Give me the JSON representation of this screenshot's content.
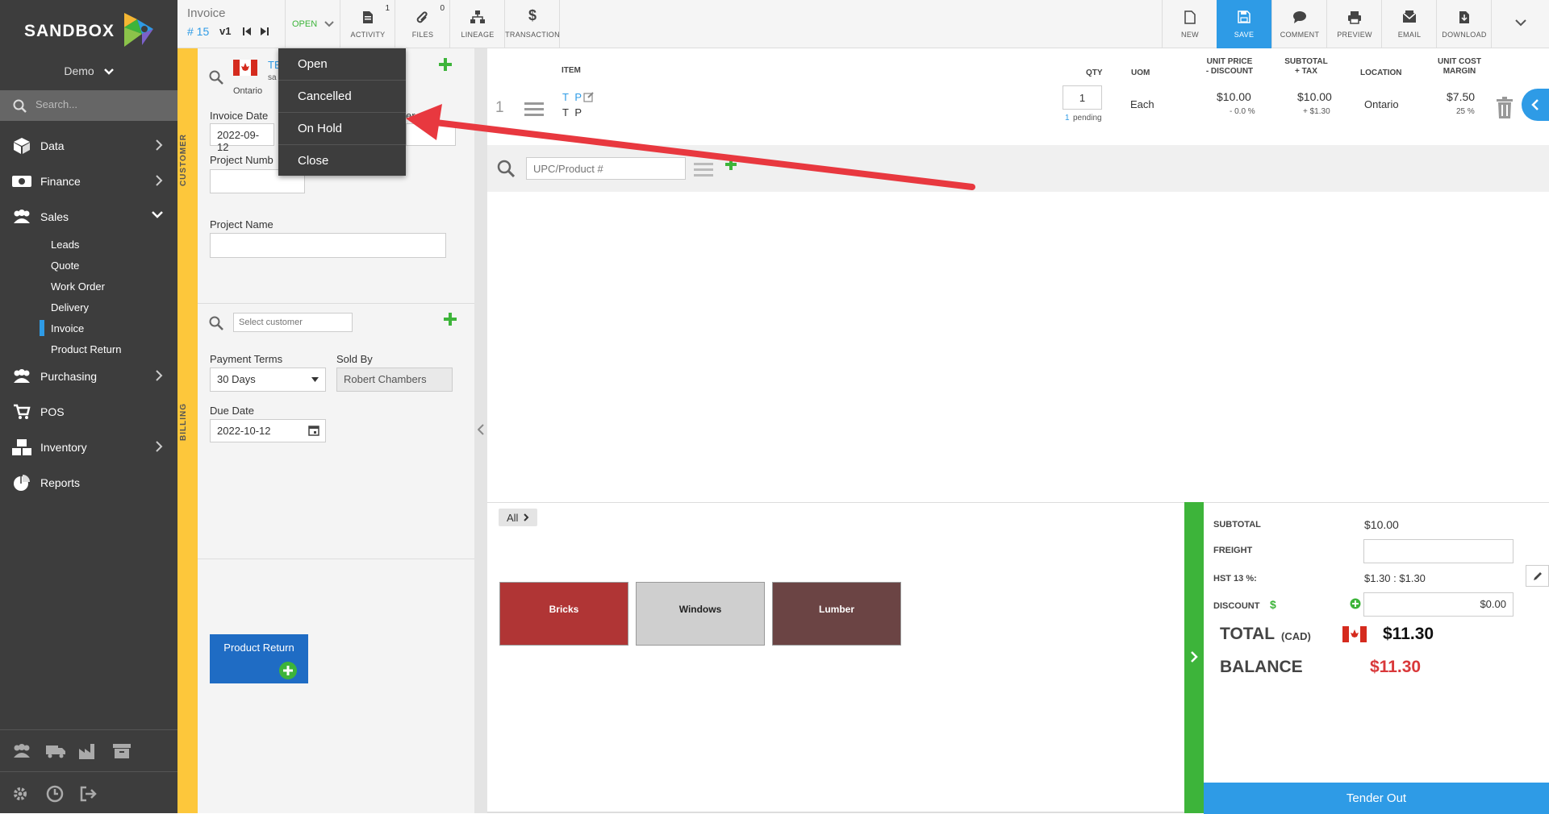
{
  "app": {
    "logo": "SANDBOX",
    "org": "Demo",
    "search_placeholder": "Search..."
  },
  "sidebar": {
    "items": [
      {
        "label": "Data",
        "icon": "cube-icon"
      },
      {
        "label": "Finance",
        "icon": "money-icon"
      },
      {
        "label": "Sales",
        "icon": "users-icon"
      },
      {
        "label": "Purchasing",
        "icon": "users-icon"
      },
      {
        "label": "POS",
        "icon": "cart-icon"
      },
      {
        "label": "Inventory",
        "icon": "boxes-icon"
      },
      {
        "label": "Reports",
        "icon": "pie-chart-icon"
      }
    ],
    "sales_sub": [
      "Leads",
      "Quote",
      "Work Order",
      "Delivery",
      "Invoice",
      "Product Return"
    ],
    "active_sub": "Invoice"
  },
  "doc": {
    "type": "Invoice",
    "number": "# 15",
    "version": "v1",
    "status": "OPEN"
  },
  "toolbar": {
    "activity": {
      "label": "ACTIVITY",
      "count": "1"
    },
    "files": {
      "label": "FILES",
      "count": "0"
    },
    "lineage": "LINEAGE",
    "transaction": "TRANSACTION",
    "new": "NEW",
    "save": "SAVE",
    "comment": "COMMENT",
    "preview": "PREVIEW",
    "email": "EMAIL",
    "download": "DOWNLOAD"
  },
  "status_menu": [
    "Open",
    "Cancelled",
    "On Hold",
    "Close"
  ],
  "customer": {
    "section": "CUSTOMER",
    "name_partial": "TE",
    "sub_partial": "sa",
    "region": "Ontario",
    "invoice_date_label": "Invoice Date",
    "invoice_date": "2022-09-12",
    "other_label_partial": "er",
    "project_number_label": "Project Numb",
    "project_name_label": "Project Name"
  },
  "billing": {
    "section": "BILLING",
    "customer_placeholder": "Select customer",
    "payment_terms_label": "Payment Terms",
    "payment_terms": "30 Days",
    "sold_by_label": "Sold By",
    "sold_by": "Robert Chambers",
    "due_date_label": "Due Date",
    "due_date": "2022-10-12"
  },
  "product_return_button": "Product Return",
  "items_header": {
    "item": "ITEM",
    "qty": "QTY",
    "uom": "UOM",
    "unit_price_1": "UNIT PRICE",
    "unit_price_2": "- DISCOUNT",
    "subtotal_1": "SUBTOTAL",
    "subtotal_2": "+ TAX",
    "location": "LOCATION",
    "unit_cost_1": "UNIT COST",
    "unit_cost_2": "MARGIN"
  },
  "line": {
    "index": "1",
    "code": "T P",
    "name": "T P",
    "qty": "1",
    "pending_count": "1",
    "pending_label": "pending",
    "uom": "Each",
    "price": "$10.00",
    "discount": "- 0.0 %",
    "subtotal": "$10.00",
    "tax": "+ $1.30",
    "location": "Ontario",
    "cost": "$7.50",
    "margin": "25 %"
  },
  "product_search_placeholder": "UPC/Product #",
  "categories": {
    "crumb": "All",
    "tiles": [
      {
        "label": "Bricks",
        "color": "#b03535",
        "text": "#ffffff"
      },
      {
        "label": "Windows",
        "color": "#cfcfcf",
        "text": "#222222"
      },
      {
        "label": "Lumber",
        "color": "#6b4444",
        "text": "#ffffff"
      }
    ]
  },
  "totals": {
    "subtotal_label": "SUBTOTAL",
    "subtotal": "$10.00",
    "freight_label": "FREIGHT",
    "hst_label": "HST 13 %:",
    "hst": "$1.30 : $1.30",
    "discount_label": "DISCOUNT",
    "discount": "$0.00",
    "total_label": "TOTAL",
    "currency": "(CAD)",
    "total": "$11.30",
    "balance_label": "BALANCE",
    "balance": "$11.30"
  },
  "tender_out": "Tender Out",
  "colors": {
    "accent": "#2e9be6",
    "green": "#3db43a",
    "yellow": "#fdc73b",
    "balance_red": "#d9383a",
    "sidebar": "#3d3d3d"
  }
}
